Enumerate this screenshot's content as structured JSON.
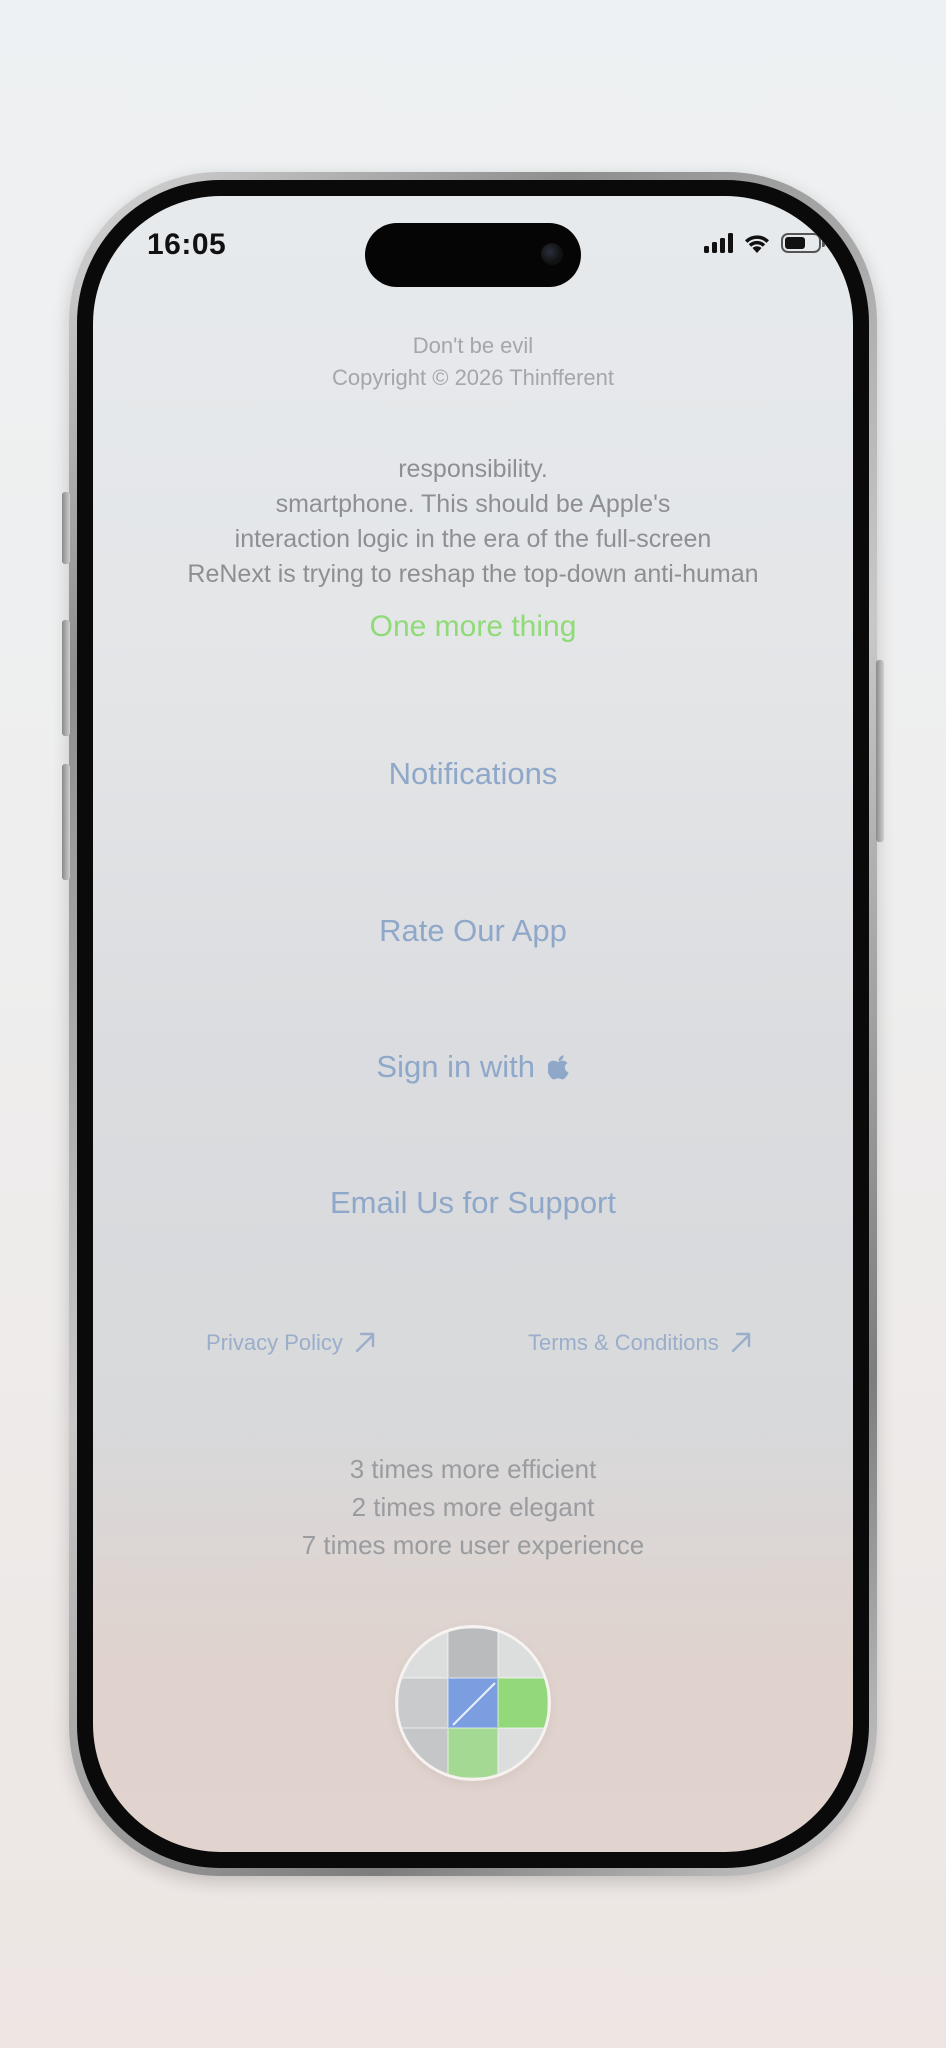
{
  "status_bar": {
    "time": "16:05"
  },
  "footer_top": {
    "motto": "Don't be evil",
    "copyright": "Copyright © 2026 Thinfferent"
  },
  "manifesto": {
    "lines": [
      "responsibility.",
      "smartphone. This should be Apple's",
      "interaction logic in the era of the full-screen",
      "ReNext is trying to reshap the top-down anti-human"
    ]
  },
  "one_more_thing": "One more thing",
  "menu": {
    "notifications": "Notifications",
    "rate_app": "Rate Our App",
    "sign_in_with": "Sign in with",
    "email_support": "Email Us for Support"
  },
  "legal": {
    "privacy": "Privacy Policy",
    "terms": "Terms & Conditions"
  },
  "stats": [
    "3 times more efficient",
    "2 times more elegant",
    "7 times more user experience"
  ],
  "colors": {
    "accent_green": "#8fdb78",
    "link_blue": "#8fa8c9",
    "text_grey": "#8d8f93"
  },
  "icons": {
    "sign_in_icon": "apple-logo-icon",
    "external_link_icon": "arrow-up-right-icon",
    "fab_icon": "grid-app-icon"
  }
}
